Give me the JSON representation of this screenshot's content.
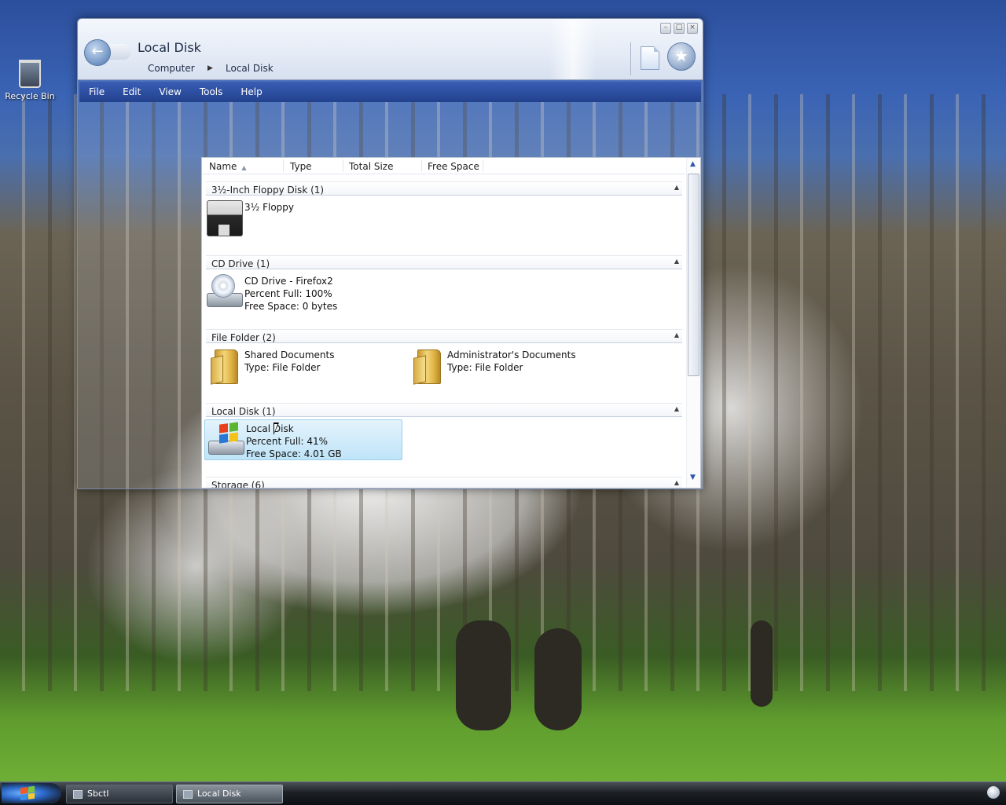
{
  "desktop": {
    "icons": [
      {
        "label": "Recycle Bin",
        "icon": "recycle-bin-icon"
      }
    ]
  },
  "window": {
    "title": "Local Disk",
    "breadcrumb": [
      "Computer",
      "Local Disk"
    ],
    "caption_buttons": [
      "minimize",
      "maximize",
      "close"
    ],
    "toolbar_icons": [
      "back-icon",
      "page-icon",
      "favorites-star-icon"
    ]
  },
  "menu": [
    "File",
    "Edit",
    "View",
    "Tools",
    "Help"
  ],
  "columns": [
    "Name",
    "Type",
    "Total Size",
    "Free Space"
  ],
  "groups": [
    {
      "label": "3½-Inch Floppy Disk (1)",
      "items": [
        {
          "icon": "floppy-icon",
          "lines": [
            "3½ Floppy"
          ]
        }
      ]
    },
    {
      "label": "CD Drive (1)",
      "items": [
        {
          "icon": "cd-drive-icon",
          "lines": [
            "CD Drive - Firefox2",
            "Percent Full: 100%",
            "Free Space: 0 bytes"
          ]
        }
      ]
    },
    {
      "label": "File Folder (2)",
      "items": [
        {
          "icon": "folder-icon",
          "lines": [
            "Shared Documents",
            "Type: File Folder"
          ]
        },
        {
          "icon": "folder-icon",
          "lines": [
            "Administrator's Documents",
            "Type: File Folder"
          ]
        }
      ]
    },
    {
      "label": "Local Disk (1)",
      "items": [
        {
          "icon": "windows-drive-icon",
          "lines": [
            "Local Disk",
            "Percent Full: 41%",
            "Free Space: 4.01 GB"
          ],
          "selected": true
        }
      ]
    },
    {
      "label": "Storage (6)",
      "items": []
    }
  ],
  "taskbar": {
    "start_icon": "windows-start-icon",
    "tasks": [
      {
        "label": "Sbctl",
        "active": false
      },
      {
        "label": "Local Disk",
        "active": true
      }
    ]
  }
}
